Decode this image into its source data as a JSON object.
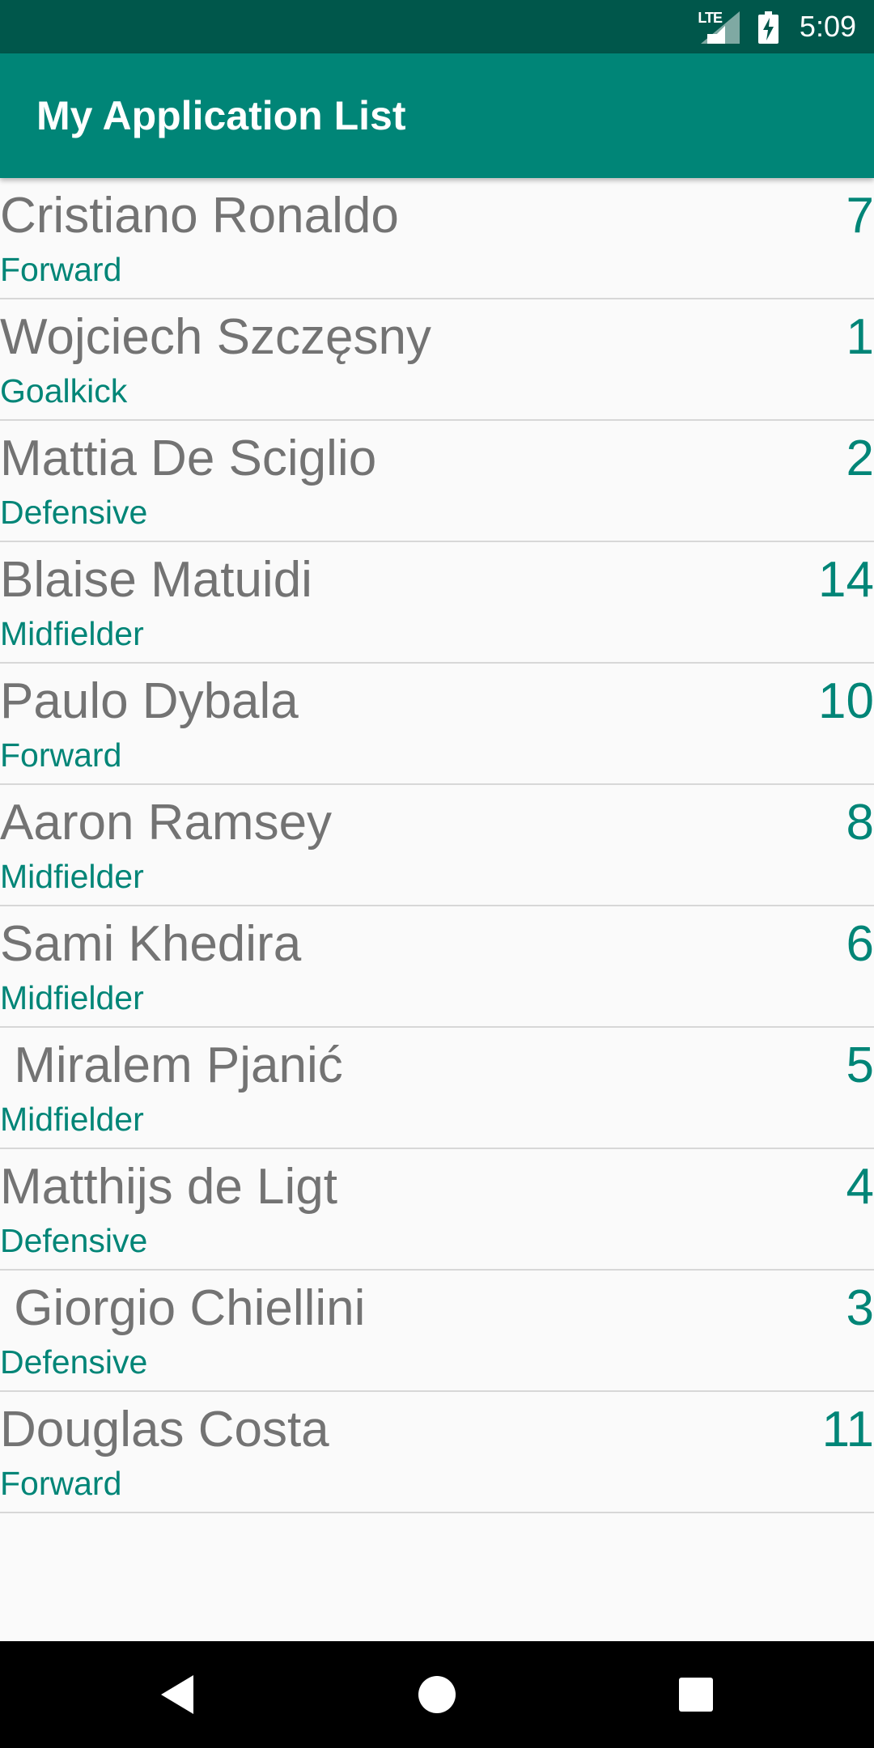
{
  "status_bar": {
    "time": "5:09",
    "network": "LTE",
    "icons": [
      "signal-icon",
      "battery-charging-icon"
    ]
  },
  "app_bar": {
    "title": "My Application List",
    "color": "#008577"
  },
  "players": [
    {
      "name": "Cristiano Ronaldo",
      "position": "Forward",
      "number": "7"
    },
    {
      "name": "Wojciech Szczęsny",
      "position": "Goalkick",
      "number": "1"
    },
    {
      "name": "Mattia De Sciglio",
      "position": "Defensive",
      "number": "2"
    },
    {
      "name": "Blaise Matuidi",
      "position": "Midfielder",
      "number": "14"
    },
    {
      "name": "Paulo Dybala",
      "position": "Forward",
      "number": "10"
    },
    {
      "name": "Aaron Ramsey",
      "position": "Midfielder",
      "number": "8"
    },
    {
      "name": "Sami Khedira",
      "position": "Midfielder",
      "number": "6"
    },
    {
      "name": " Miralem Pjanić",
      "position": "Midfielder",
      "number": "5"
    },
    {
      "name": "Matthijs de Ligt",
      "position": "Defensive",
      "number": "4"
    },
    {
      "name": " Giorgio Chiellini",
      "position": "Defensive",
      "number": "3"
    },
    {
      "name": "Douglas Costa",
      "position": "Forward",
      "number": "11"
    }
  ],
  "nav_bar": {
    "icons": [
      "back-icon",
      "home-icon",
      "recents-icon"
    ]
  },
  "colors": {
    "status_bar": "#00574b",
    "accent": "#008577",
    "name_text": "#737373",
    "background": "#fafafa"
  }
}
